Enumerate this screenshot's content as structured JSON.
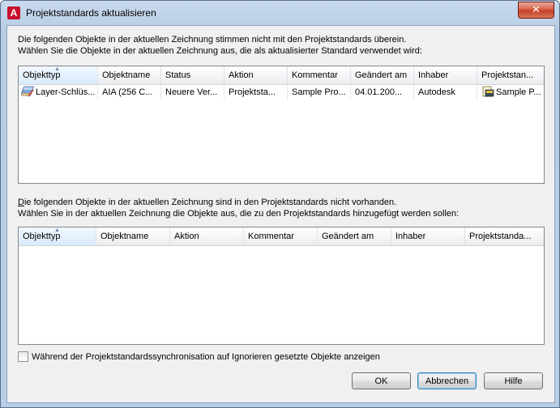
{
  "window": {
    "title": "Projektstandards aktualisieren",
    "close_label": "✕",
    "icon_label": "A"
  },
  "section1": {
    "line1": "Die folgenden Objekte in der aktuellen Zeichnung stimmen nicht mit den Projektstandards überein.",
    "line2": "Wählen Sie die Objekte in der aktuellen Zeichnung aus, die als aktualisierter Standard verwendet wird:",
    "columns": [
      "Objekttyp",
      "Objektname",
      "Status",
      "Aktion",
      "Kommentar",
      "Geändert am",
      "Inhaber",
      "Projektstan..."
    ],
    "rows": [
      [
        "Layer-Schlüs...",
        "AIA (256 C...",
        "Neuere Ver...",
        "Projektsta...",
        "Sample Pro...",
        "04.01.200...",
        "Autodesk",
        "Sample P..."
      ]
    ]
  },
  "section2": {
    "line1": "Die folgenden Objekte in der aktuellen Zeichnung sind in den Projektstandards nicht vorhanden.",
    "line2": "Wählen Sie in der aktuellen Zeichnung die Objekte aus, die zu den Projektstandards hinzugefügt werden sollen:",
    "columns": [
      "Objekttyp",
      "Objektname",
      "Aktion",
      "Kommentar",
      "Geändert am",
      "Inhaber",
      "Projektstanda..."
    ]
  },
  "checkbox": {
    "label": "Während der Projektstandardssynchronisation auf Ignorieren gesetzte Objekte anzeigen",
    "checked": false
  },
  "buttons": {
    "ok": "OK",
    "cancel": "Abbrechen",
    "help": "Hilfe"
  },
  "colors": {
    "title_bar": "#b9cde6",
    "close_button": "#c23b22",
    "sorted_column": "#e3f0fd"
  }
}
